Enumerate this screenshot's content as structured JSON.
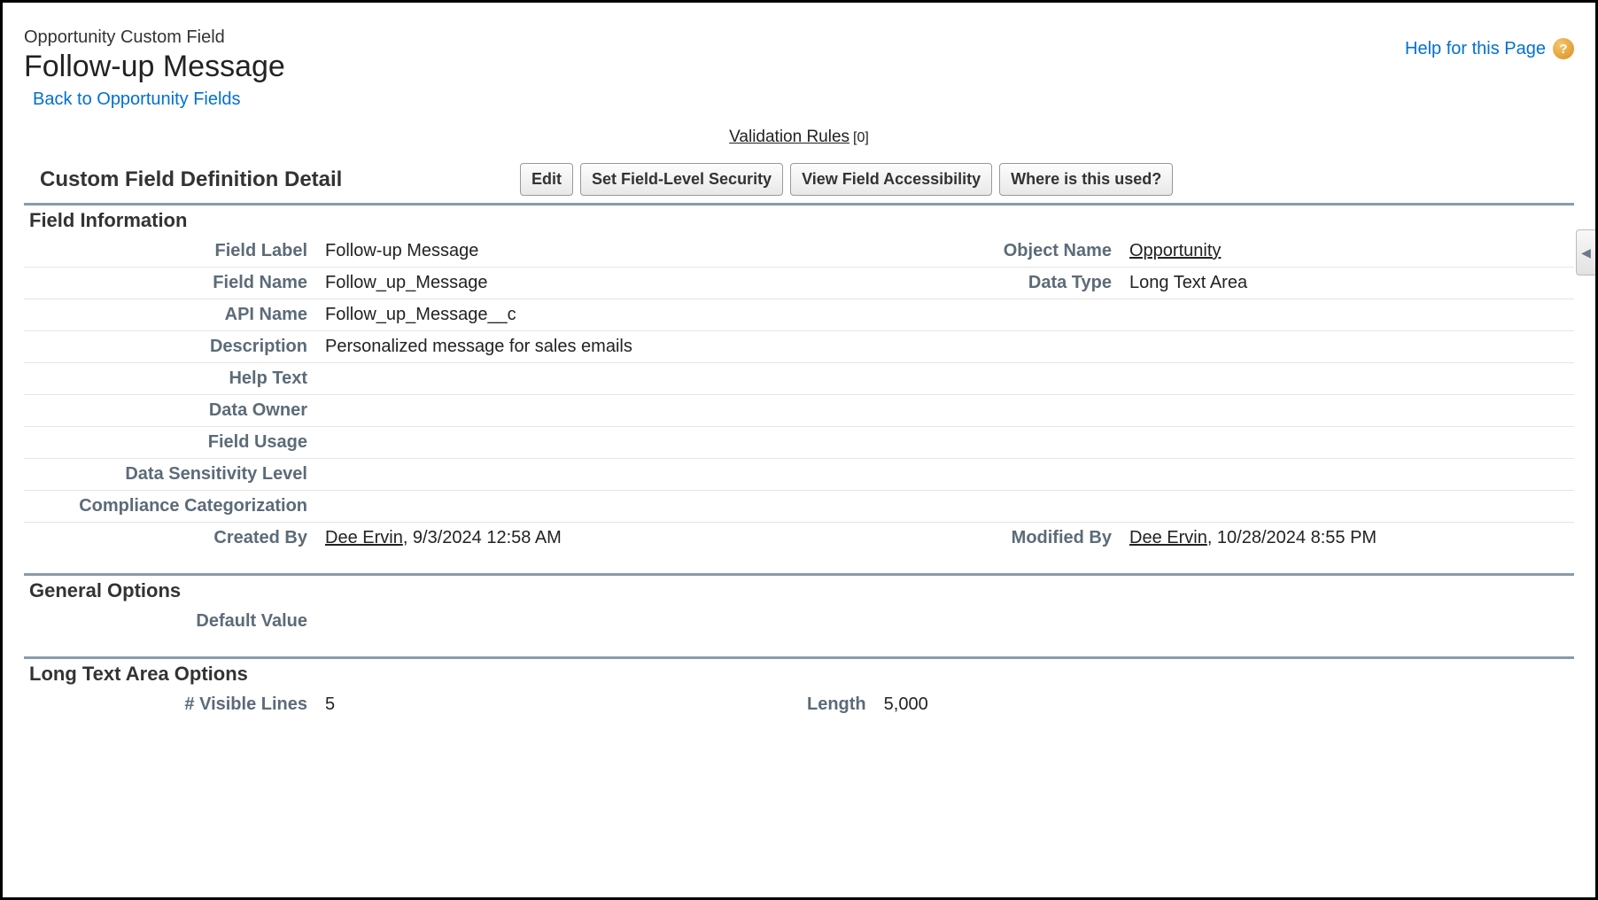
{
  "header": {
    "breadcrumb": "Opportunity Custom Field",
    "title": "Follow-up Message",
    "back_link": "Back to Opportunity Fields",
    "help_label": "Help for this Page"
  },
  "anchors": {
    "validation_rules_label": "Validation Rules",
    "validation_rules_count": "[0]"
  },
  "section": {
    "title": "Custom Field Definition Detail",
    "buttons": {
      "edit": "Edit",
      "fls": "Set Field-Level Security",
      "accessibility": "View Field Accessibility",
      "where_used": "Where is this used?"
    }
  },
  "field_info": {
    "heading": "Field Information",
    "labels": {
      "field_label": "Field Label",
      "object_name": "Object Name",
      "field_name": "Field Name",
      "data_type": "Data Type",
      "api_name": "API Name",
      "description": "Description",
      "help_text": "Help Text",
      "data_owner": "Data Owner",
      "field_usage": "Field Usage",
      "data_sensitivity": "Data Sensitivity Level",
      "compliance": "Compliance Categorization",
      "created_by": "Created By",
      "modified_by": "Modified By"
    },
    "values": {
      "field_label": "Follow-up Message",
      "object_name": "Opportunity",
      "field_name": "Follow_up_Message",
      "data_type": "Long Text Area",
      "api_name": "Follow_up_Message__c",
      "description": "Personalized message for sales emails",
      "help_text": "",
      "data_owner": "",
      "field_usage": "",
      "data_sensitivity": "",
      "compliance": "",
      "created_by_user": "Dee Ervin",
      "created_by_date": ", 9/3/2024 12:58 AM",
      "modified_by_user": "Dee Ervin",
      "modified_by_date": ", 10/28/2024 8:55 PM"
    }
  },
  "general_options": {
    "heading": "General Options",
    "labels": {
      "default_value": "Default Value"
    },
    "values": {
      "default_value": ""
    }
  },
  "lta_options": {
    "heading": "Long Text Area Options",
    "labels": {
      "visible_lines": "# Visible Lines",
      "length": "Length"
    },
    "values": {
      "visible_lines": "5",
      "length": "5,000"
    }
  }
}
